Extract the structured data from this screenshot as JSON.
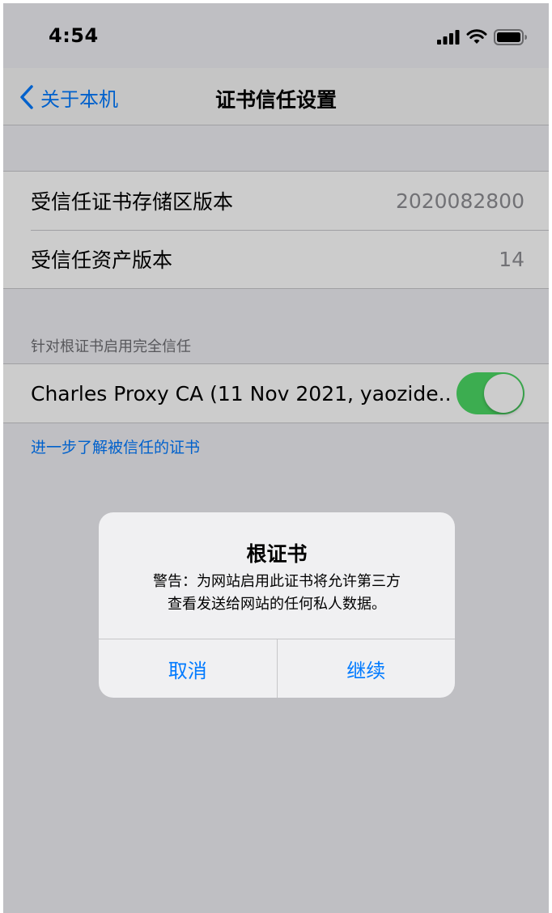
{
  "status_bar": {
    "time": "4:54",
    "icons": [
      "cellular-signal-icon",
      "wifi-icon",
      "battery-icon"
    ]
  },
  "nav": {
    "back_label": "关于本机",
    "title": "证书信任设置"
  },
  "versions": {
    "items": [
      {
        "label": "受信任证书存储区版本",
        "value": "2020082800"
      },
      {
        "label": "受信任资产版本",
        "value": "14"
      }
    ]
  },
  "trust_section": {
    "header": "针对根证书启用完全信任",
    "certificate": {
      "label": "Charles Proxy CA (11 Nov 2021, yaozide...",
      "enabled": true
    },
    "learn_more": "进一步了解被信任的证书"
  },
  "alert": {
    "title": "根证书",
    "message_line1": "警告：为网站启用此证书将允许第三方",
    "message_line2": "查看发送给网站的任何私人数据。",
    "cancel_label": "取消",
    "continue_label": "继续"
  },
  "colors": {
    "accent": "#007aff",
    "toggle_on": "#4cd964",
    "background": "#efeff4"
  }
}
